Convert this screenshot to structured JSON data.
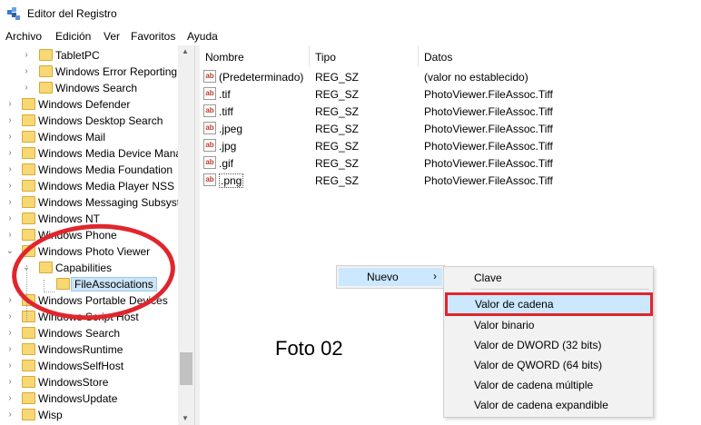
{
  "window": {
    "title": "Editor del Registro"
  },
  "menu": [
    "Archivo",
    "Edición",
    "Ver",
    "Favoritos",
    "Ayuda"
  ],
  "tree": [
    {
      "label": "TabletPC",
      "expander": "›",
      "level": 2
    },
    {
      "label": "Windows Error Reporting",
      "expander": "›",
      "level": 2
    },
    {
      "label": "Windows Search",
      "expander": "›",
      "level": 2
    },
    {
      "label": "Windows Defender",
      "expander": "›",
      "level": 1
    },
    {
      "label": "Windows Desktop Search",
      "expander": "›",
      "level": 1
    },
    {
      "label": "Windows Mail",
      "expander": "›",
      "level": 1
    },
    {
      "label": "Windows Media Device Mana",
      "expander": "›",
      "level": 1
    },
    {
      "label": "Windows Media Foundation",
      "expander": "›",
      "level": 1
    },
    {
      "label": "Windows Media Player NSS",
      "expander": "›",
      "level": 1
    },
    {
      "label": "Windows Messaging Subsyste",
      "expander": "›",
      "level": 1
    },
    {
      "label": "Windows NT",
      "expander": "›",
      "level": 1
    },
    {
      "label": "Windows Phone",
      "expander": "›",
      "level": 1
    },
    {
      "label": "Windows Photo Viewer",
      "expander": "⌄",
      "level": 1
    },
    {
      "label": "Capabilities",
      "expander": "⌄",
      "level": 2
    },
    {
      "label": "FileAssociations",
      "expander": "",
      "level": 3,
      "selected": true
    },
    {
      "label": "Windows Portable Devices",
      "expander": "›",
      "level": 1
    },
    {
      "label": "Windows Script Host",
      "expander": "›",
      "level": 1
    },
    {
      "label": "Windows Search",
      "expander": "›",
      "level": 1
    },
    {
      "label": "WindowsRuntime",
      "expander": "›",
      "level": 1
    },
    {
      "label": "WindowsSelfHost",
      "expander": "›",
      "level": 1
    },
    {
      "label": "WindowsStore",
      "expander": "›",
      "level": 1
    },
    {
      "label": "WindowsUpdate",
      "expander": "›",
      "level": 1
    },
    {
      "label": "Wisp",
      "expander": "›",
      "level": 1
    }
  ],
  "list": {
    "headers": {
      "name": "Nombre",
      "type": "Tipo",
      "data": "Datos"
    },
    "icon_text": "ab",
    "rows": [
      {
        "name": "(Predeterminado)",
        "type": "REG_SZ",
        "data": "(valor no establecido)"
      },
      {
        "name": ".tif",
        "type": "REG_SZ",
        "data": "PhotoViewer.FileAssoc.Tiff"
      },
      {
        "name": ".tiff",
        "type": "REG_SZ",
        "data": "PhotoViewer.FileAssoc.Tiff"
      },
      {
        "name": ".jpeg",
        "type": "REG_SZ",
        "data": "PhotoViewer.FileAssoc.Tiff"
      },
      {
        "name": ".jpg",
        "type": "REG_SZ",
        "data": "PhotoViewer.FileAssoc.Tiff"
      },
      {
        "name": ".gif",
        "type": "REG_SZ",
        "data": "PhotoViewer.FileAssoc.Tiff"
      },
      {
        "name": ".png",
        "type": "REG_SZ",
        "data": "PhotoViewer.FileAssoc.Tiff"
      }
    ]
  },
  "context_menu": {
    "nuevo": "Nuevo",
    "arrow": "›",
    "submenu": [
      "Clave",
      "Valor de cadena",
      "Valor binario",
      "Valor de DWORD (32 bits)",
      "Valor de QWORD (64 bits)",
      "Valor de cadena múltiple",
      "Valor de cadena expandible"
    ]
  },
  "annotation": {
    "caption": "Foto 02"
  },
  "colors": {
    "highlight": "#e0262d",
    "menu_hover": "#cce8ff",
    "folder": "#f8d775"
  }
}
